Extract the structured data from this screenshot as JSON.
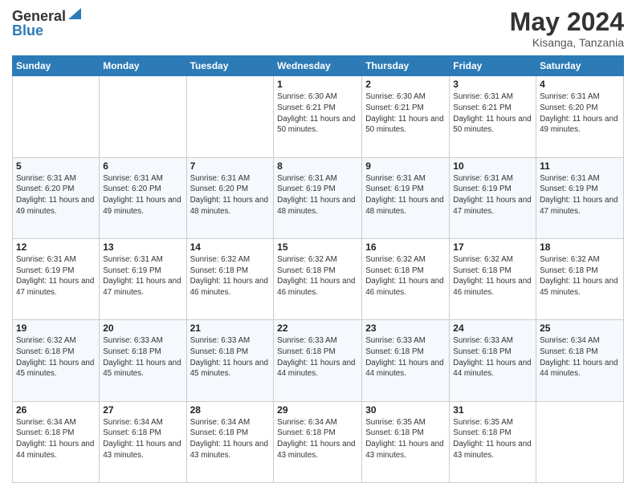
{
  "logo": {
    "general": "General",
    "blue": "Blue"
  },
  "header": {
    "month": "May 2024",
    "location": "Kisanga, Tanzania"
  },
  "weekdays": [
    "Sunday",
    "Monday",
    "Tuesday",
    "Wednesday",
    "Thursday",
    "Friday",
    "Saturday"
  ],
  "weeks": [
    [
      {
        "day": "",
        "sunrise": "",
        "sunset": "",
        "daylight": ""
      },
      {
        "day": "",
        "sunrise": "",
        "sunset": "",
        "daylight": ""
      },
      {
        "day": "",
        "sunrise": "",
        "sunset": "",
        "daylight": ""
      },
      {
        "day": "1",
        "sunrise": "Sunrise: 6:30 AM",
        "sunset": "Sunset: 6:21 PM",
        "daylight": "Daylight: 11 hours and 50 minutes."
      },
      {
        "day": "2",
        "sunrise": "Sunrise: 6:30 AM",
        "sunset": "Sunset: 6:21 PM",
        "daylight": "Daylight: 11 hours and 50 minutes."
      },
      {
        "day": "3",
        "sunrise": "Sunrise: 6:31 AM",
        "sunset": "Sunset: 6:21 PM",
        "daylight": "Daylight: 11 hours and 50 minutes."
      },
      {
        "day": "4",
        "sunrise": "Sunrise: 6:31 AM",
        "sunset": "Sunset: 6:20 PM",
        "daylight": "Daylight: 11 hours and 49 minutes."
      }
    ],
    [
      {
        "day": "5",
        "sunrise": "Sunrise: 6:31 AM",
        "sunset": "Sunset: 6:20 PM",
        "daylight": "Daylight: 11 hours and 49 minutes."
      },
      {
        "day": "6",
        "sunrise": "Sunrise: 6:31 AM",
        "sunset": "Sunset: 6:20 PM",
        "daylight": "Daylight: 11 hours and 49 minutes."
      },
      {
        "day": "7",
        "sunrise": "Sunrise: 6:31 AM",
        "sunset": "Sunset: 6:20 PM",
        "daylight": "Daylight: 11 hours and 48 minutes."
      },
      {
        "day": "8",
        "sunrise": "Sunrise: 6:31 AM",
        "sunset": "Sunset: 6:19 PM",
        "daylight": "Daylight: 11 hours and 48 minutes."
      },
      {
        "day": "9",
        "sunrise": "Sunrise: 6:31 AM",
        "sunset": "Sunset: 6:19 PM",
        "daylight": "Daylight: 11 hours and 48 minutes."
      },
      {
        "day": "10",
        "sunrise": "Sunrise: 6:31 AM",
        "sunset": "Sunset: 6:19 PM",
        "daylight": "Daylight: 11 hours and 47 minutes."
      },
      {
        "day": "11",
        "sunrise": "Sunrise: 6:31 AM",
        "sunset": "Sunset: 6:19 PM",
        "daylight": "Daylight: 11 hours and 47 minutes."
      }
    ],
    [
      {
        "day": "12",
        "sunrise": "Sunrise: 6:31 AM",
        "sunset": "Sunset: 6:19 PM",
        "daylight": "Daylight: 11 hours and 47 minutes."
      },
      {
        "day": "13",
        "sunrise": "Sunrise: 6:31 AM",
        "sunset": "Sunset: 6:19 PM",
        "daylight": "Daylight: 11 hours and 47 minutes."
      },
      {
        "day": "14",
        "sunrise": "Sunrise: 6:32 AM",
        "sunset": "Sunset: 6:18 PM",
        "daylight": "Daylight: 11 hours and 46 minutes."
      },
      {
        "day": "15",
        "sunrise": "Sunrise: 6:32 AM",
        "sunset": "Sunset: 6:18 PM",
        "daylight": "Daylight: 11 hours and 46 minutes."
      },
      {
        "day": "16",
        "sunrise": "Sunrise: 6:32 AM",
        "sunset": "Sunset: 6:18 PM",
        "daylight": "Daylight: 11 hours and 46 minutes."
      },
      {
        "day": "17",
        "sunrise": "Sunrise: 6:32 AM",
        "sunset": "Sunset: 6:18 PM",
        "daylight": "Daylight: 11 hours and 46 minutes."
      },
      {
        "day": "18",
        "sunrise": "Sunrise: 6:32 AM",
        "sunset": "Sunset: 6:18 PM",
        "daylight": "Daylight: 11 hours and 45 minutes."
      }
    ],
    [
      {
        "day": "19",
        "sunrise": "Sunrise: 6:32 AM",
        "sunset": "Sunset: 6:18 PM",
        "daylight": "Daylight: 11 hours and 45 minutes."
      },
      {
        "day": "20",
        "sunrise": "Sunrise: 6:33 AM",
        "sunset": "Sunset: 6:18 PM",
        "daylight": "Daylight: 11 hours and 45 minutes."
      },
      {
        "day": "21",
        "sunrise": "Sunrise: 6:33 AM",
        "sunset": "Sunset: 6:18 PM",
        "daylight": "Daylight: 11 hours and 45 minutes."
      },
      {
        "day": "22",
        "sunrise": "Sunrise: 6:33 AM",
        "sunset": "Sunset: 6:18 PM",
        "daylight": "Daylight: 11 hours and 44 minutes."
      },
      {
        "day": "23",
        "sunrise": "Sunrise: 6:33 AM",
        "sunset": "Sunset: 6:18 PM",
        "daylight": "Daylight: 11 hours and 44 minutes."
      },
      {
        "day": "24",
        "sunrise": "Sunrise: 6:33 AM",
        "sunset": "Sunset: 6:18 PM",
        "daylight": "Daylight: 11 hours and 44 minutes."
      },
      {
        "day": "25",
        "sunrise": "Sunrise: 6:34 AM",
        "sunset": "Sunset: 6:18 PM",
        "daylight": "Daylight: 11 hours and 44 minutes."
      }
    ],
    [
      {
        "day": "26",
        "sunrise": "Sunrise: 6:34 AM",
        "sunset": "Sunset: 6:18 PM",
        "daylight": "Daylight: 11 hours and 44 minutes."
      },
      {
        "day": "27",
        "sunrise": "Sunrise: 6:34 AM",
        "sunset": "Sunset: 6:18 PM",
        "daylight": "Daylight: 11 hours and 43 minutes."
      },
      {
        "day": "28",
        "sunrise": "Sunrise: 6:34 AM",
        "sunset": "Sunset: 6:18 PM",
        "daylight": "Daylight: 11 hours and 43 minutes."
      },
      {
        "day": "29",
        "sunrise": "Sunrise: 6:34 AM",
        "sunset": "Sunset: 6:18 PM",
        "daylight": "Daylight: 11 hours and 43 minutes."
      },
      {
        "day": "30",
        "sunrise": "Sunrise: 6:35 AM",
        "sunset": "Sunset: 6:18 PM",
        "daylight": "Daylight: 11 hours and 43 minutes."
      },
      {
        "day": "31",
        "sunrise": "Sunrise: 6:35 AM",
        "sunset": "Sunset: 6:18 PM",
        "daylight": "Daylight: 11 hours and 43 minutes."
      },
      {
        "day": "",
        "sunrise": "",
        "sunset": "",
        "daylight": ""
      }
    ]
  ]
}
